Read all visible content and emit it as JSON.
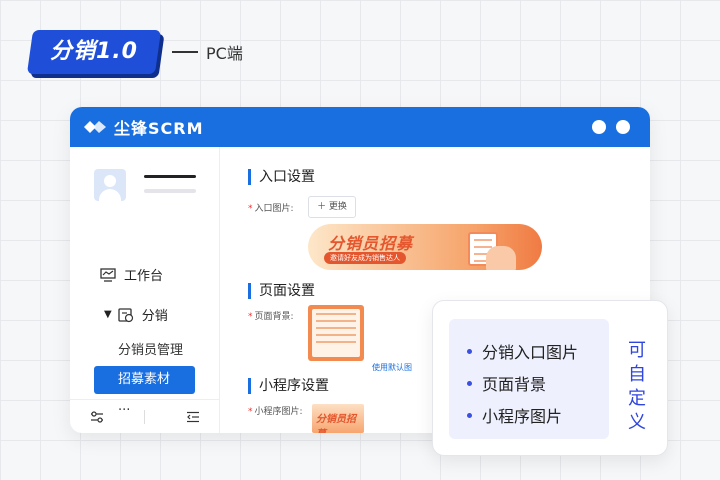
{
  "header": {
    "badge_text": "分销1.0",
    "subtitle": "PC端"
  },
  "window": {
    "brand": "尘锋SCRM",
    "accent_color": "#1a6fe0"
  },
  "sidebar": {
    "items": [
      {
        "label": "工作台",
        "icon": "monitor-icon"
      },
      {
        "label": "分销",
        "icon": "distribution-icon",
        "expanded": true
      }
    ],
    "sub_items": [
      {
        "label": "分销员管理",
        "active": false
      },
      {
        "label": "招募素材",
        "active": true
      }
    ],
    "more": "...",
    "footer_icons": [
      "settings-sliders-icon",
      "collapse-menu-icon"
    ]
  },
  "content": {
    "sections": [
      {
        "title": "入口设置",
        "field_label": "入口图片:",
        "button": "＋ 更换"
      },
      {
        "title": "页面设置",
        "field_label": "页面背景:",
        "link": "使用默认图"
      },
      {
        "title": "小程序设置",
        "field_label": "小程序图片:"
      }
    ],
    "entry_banner": {
      "title": "分销员招募",
      "subtitle": "邀请好友成为销售达人"
    },
    "mini_thumb_text": "分销员招募"
  },
  "callout": {
    "items": [
      "分销入口图片",
      "页面背景",
      "小程序图片"
    ],
    "side_text": "可自定义"
  }
}
